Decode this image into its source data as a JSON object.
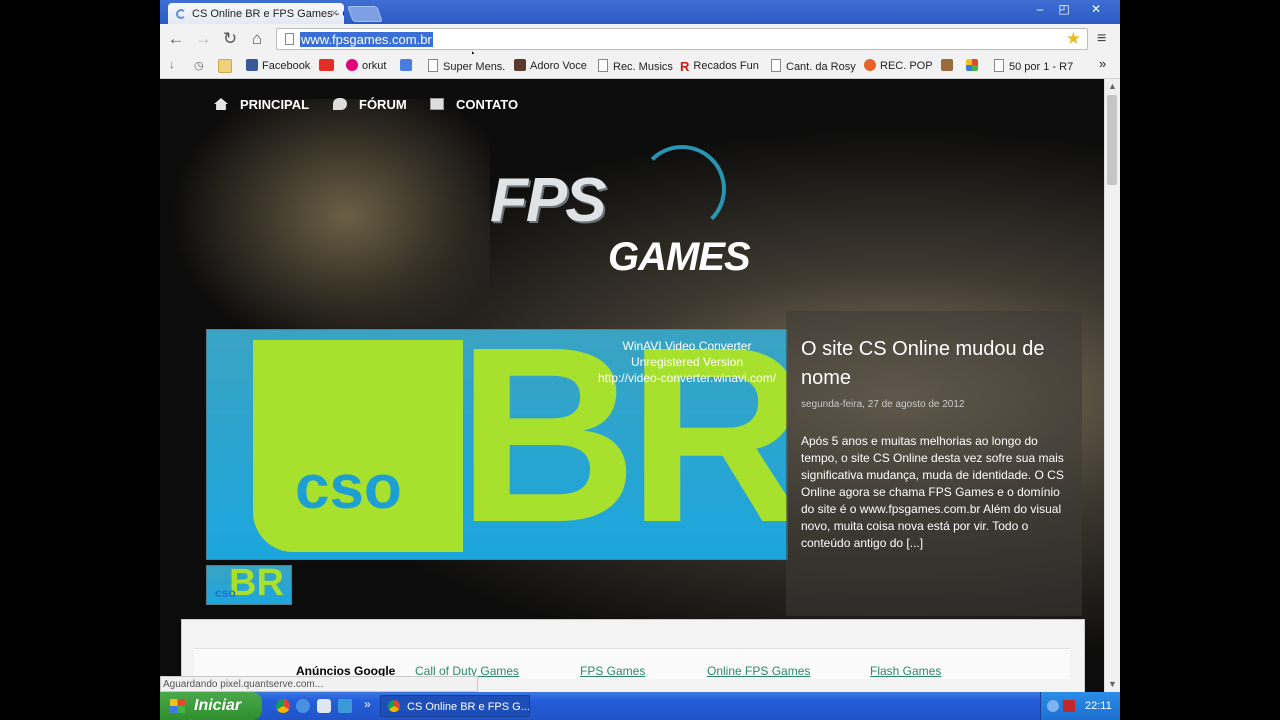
{
  "browser": {
    "tab_title": "CS Online BR e FPS Games - C",
    "tab_close": "×",
    "window_controls": [
      "–",
      "◰",
      "✕"
    ],
    "url": "www.fpsgames.com.br",
    "nav": {
      "back": "←",
      "forward": "→",
      "reload": "↻",
      "home": "⌂"
    },
    "star": "★",
    "menu": "≡",
    "status_text": "Aguardando pixel.quantserve.com..."
  },
  "bookmarks": {
    "items": [
      "Facebook",
      "orkut",
      "Super Mens.",
      "Adoro Voce",
      "Rec. Musics",
      "Recados Fun",
      "Cant. da Rosy",
      "REC. POP",
      "50 por 1 - R7"
    ],
    "more": "»"
  },
  "site": {
    "nav": [
      "PRINCIPAL",
      "FÓRUM",
      "CONTATO"
    ],
    "logo_top": "FPS",
    "logo_bottom": "GAMES",
    "feature": {
      "watermark": [
        "WinAVI Video Converter",
        "Unregistered Version",
        "http://video-converter.winavi.com/"
      ],
      "big_text": "BR",
      "small_text": "cso"
    },
    "thumb": {
      "big": "BR",
      "small": "cso"
    },
    "article": {
      "title": "O site CS Online mudou de nome",
      "date": "segunda-feira, 27 de agosto de 2012",
      "body": "Após 5 anos e muitas melhorias ao longo do tempo, o site CS Online desta vez sofre sua mais significativa mudança, muda de identidade. O CS Online agora se chama FPS Games e o domínio do site é o www.fpsgames.com.br Além do visual novo, muita coisa nova está por vir. Todo o conteúdo antigo do [...]"
    },
    "ads": {
      "header": "Anúncios Google",
      "links": [
        "Call of Duty Games",
        "FPS Games",
        "Online FPS Games",
        "Flash Games"
      ]
    }
  },
  "taskbar": {
    "start": "Iniciar",
    "task": "CS Online BR e FPS G...",
    "quicklaunch_more": "»",
    "clock": "22:11"
  },
  "colors": {
    "accent_blue": "#2a5bc4",
    "brand_green": "#a8e02e",
    "brand_cyan": "#1ba6dd",
    "ad_link": "#2a8b6b"
  }
}
